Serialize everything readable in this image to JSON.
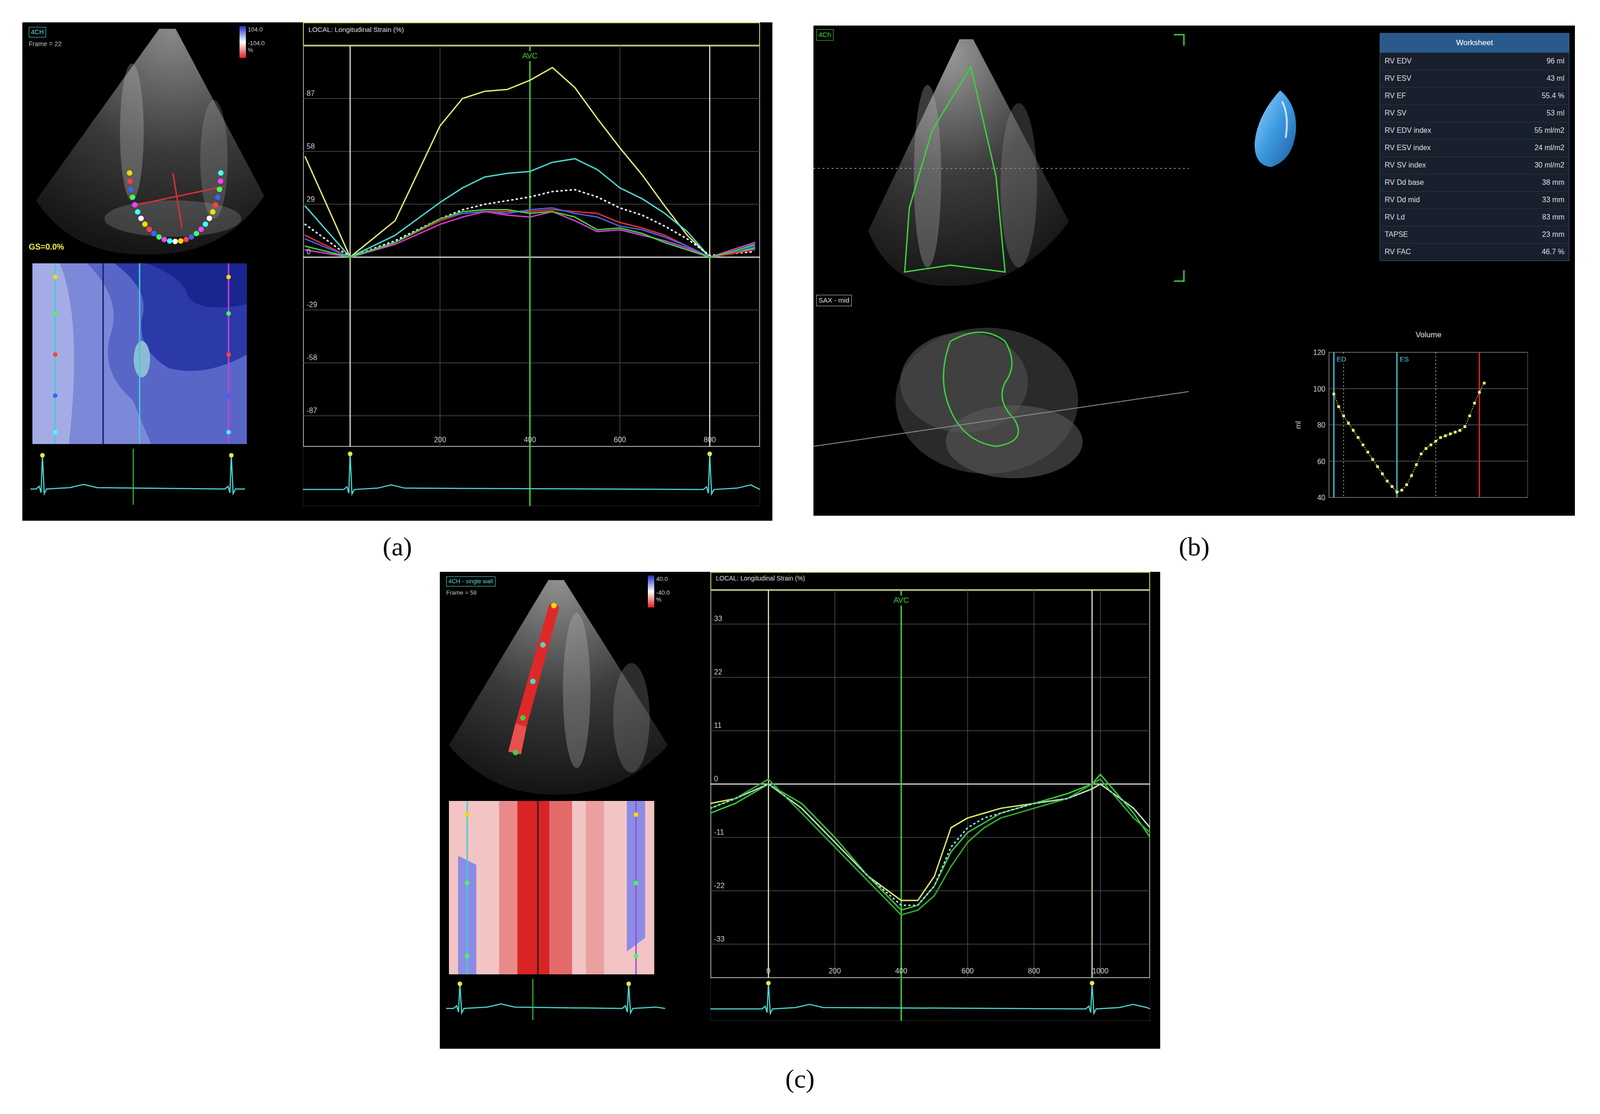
{
  "panel_a": {
    "caption": "(a)",
    "view_label": "4CH",
    "frame": "Frame = 22",
    "color_scale": {
      "max": "104.0",
      "unit": "%",
      "min": "-104.0"
    },
    "global_strain": "GS=0.0%",
    "chart": {
      "title": "LOCAL: Longitudinal Strain (%)",
      "marker": {
        "label": "AVC",
        "x": 400
      },
      "event_lines": [
        0,
        800
      ],
      "x_range": [
        -105,
        912
      ],
      "y_range": [
        -104,
        116
      ],
      "y_ticks": [
        "87",
        "58",
        "29",
        "0",
        "-29",
        "-58",
        "-87"
      ],
      "x_ticks": [
        "200",
        "400",
        "600",
        "800"
      ],
      "x": [
        -100,
        0,
        100,
        200,
        250,
        300,
        350,
        400,
        450,
        500,
        550,
        600,
        650,
        700,
        750,
        800,
        850,
        900
      ],
      "series": [
        {
          "color": "#e6e66a",
          "kind": "solid",
          "values": [
            55,
            0,
            20,
            72,
            87,
            91,
            92,
            97,
            104,
            93,
            76,
            60,
            45,
            28,
            12,
            0,
            3,
            6
          ]
        },
        {
          "color": "#4ad8d0",
          "kind": "solid",
          "values": [
            28,
            0,
            12,
            30,
            38,
            44,
            46,
            47,
            52,
            54,
            48,
            38,
            32,
            24,
            14,
            0,
            2,
            5
          ]
        },
        {
          "color": "#ffffff",
          "kind": "dotted",
          "values": [
            18,
            0,
            9,
            21,
            26,
            29,
            31,
            33,
            36,
            37,
            33,
            27,
            23,
            17,
            10,
            1,
            2,
            3
          ]
        },
        {
          "color": "#e03030",
          "kind": "solid",
          "values": [
            12,
            0,
            8,
            20,
            24,
            25,
            25,
            25,
            26,
            25,
            24,
            19,
            16,
            12,
            6,
            0,
            2,
            4
          ]
        },
        {
          "color": "#4a60e0",
          "kind": "solid",
          "values": [
            10,
            0,
            8,
            21,
            24,
            25,
            24,
            26,
            27,
            24,
            22,
            17,
            15,
            11,
            6,
            0,
            3,
            6
          ]
        },
        {
          "color": "#d040d0",
          "kind": "solid",
          "values": [
            4,
            0,
            7,
            18,
            22,
            25,
            23,
            22,
            25,
            20,
            14,
            15,
            12,
            9,
            5,
            0,
            4,
            8
          ]
        },
        {
          "color": "#40d040",
          "kind": "solid",
          "values": [
            6,
            0,
            8,
            21,
            25,
            26,
            26,
            24,
            25,
            22,
            15,
            16,
            13,
            8,
            4,
            0,
            3,
            7
          ]
        }
      ]
    }
  },
  "panel_b": {
    "caption": "(b)",
    "view_labels": [
      "4Ch",
      "SAX - mid"
    ],
    "worksheet": {
      "title": "Worksheet",
      "rows": [
        {
          "label": "RV EDV",
          "value": "96 ml"
        },
        {
          "label": "RV ESV",
          "value": "43 ml"
        },
        {
          "label": "RV EF",
          "value": "55.4 %"
        },
        {
          "label": "RV SV",
          "value": "53 ml"
        },
        {
          "label": "RV EDV index",
          "value": "55 ml/m2"
        },
        {
          "label": "RV ESV index",
          "value": "24 ml/m2"
        },
        {
          "label": "RV SV index",
          "value": "30 ml/m2"
        },
        {
          "label": "RV Dd base",
          "value": "38 mm"
        },
        {
          "label": "RV Dd mid",
          "value": "33 mm"
        },
        {
          "label": "RV Ld",
          "value": "83 mm"
        },
        {
          "label": "TAPSE",
          "value": "23 mm"
        },
        {
          "label": "RV FAC",
          "value": "46.7 %"
        }
      ]
    },
    "volume_chart": {
      "title": "Volume",
      "y_label": "ml",
      "y_ticks": [
        "120",
        "100",
        "80",
        "60",
        "40"
      ],
      "y_range": [
        40,
        120
      ],
      "x_range": [
        -1,
        40
      ],
      "markers": [
        {
          "label": "ED",
          "index": 0
        },
        {
          "label": "ES",
          "index": 13
        }
      ],
      "event_lines": [
        2,
        21
      ],
      "end_line": 30,
      "values": [
        97,
        90,
        85,
        81,
        77,
        73,
        69,
        65,
        61,
        57,
        53,
        49,
        46,
        43,
        44,
        47,
        52,
        58,
        64,
        67,
        69,
        71,
        73,
        74,
        75,
        76,
        77,
        79,
        85,
        92,
        98,
        103
      ]
    }
  },
  "panel_c": {
    "caption": "(c)",
    "view_label": "4CH - single wall",
    "frame": "Frame = 58",
    "color_scale": {
      "max": "40.0",
      "unit": "%",
      "min": "-40.0"
    },
    "chart": {
      "title": "LOCAL: Longitudinal Strain (%)",
      "marker": {
        "label": "AVC",
        "x": 400
      },
      "event_lines": [
        0,
        975
      ],
      "x_range": [
        -175,
        1150
      ],
      "y_range": [
        -40,
        40
      ],
      "y_ticks": [
        "33",
        "22",
        "11",
        "0",
        "-11",
        "-22",
        "-33"
      ],
      "x_ticks": [
        "0",
        "200",
        "400",
        "600",
        "800",
        "1000"
      ],
      "x": [
        -175,
        -100,
        0,
        100,
        200,
        300,
        400,
        450,
        500,
        550,
        600,
        650,
        700,
        800,
        900,
        975,
        1000,
        1100,
        1150
      ],
      "series": [
        {
          "color": "#e6e66a",
          "kind": "solid",
          "values": [
            -4,
            -3,
            0,
            -5,
            -12,
            -19,
            -24,
            -24,
            -19,
            -9,
            -7,
            -6,
            -5,
            -4,
            -3,
            -1,
            0,
            -5,
            -9
          ]
        },
        {
          "color": "#3cc83c",
          "kind": "solid",
          "values": [
            -6,
            -4,
            0,
            -4,
            -11,
            -19,
            -26,
            -25,
            -21,
            -14,
            -10,
            -8,
            -6,
            -4,
            -2,
            0,
            2,
            -6,
            -11
          ]
        },
        {
          "color": "#2fae2f",
          "kind": "solid",
          "values": [
            -5,
            -3,
            1,
            -6,
            -13,
            -20,
            -27,
            -26,
            -23,
            -17,
            -12,
            -9,
            -7,
            -5,
            -3,
            0,
            1,
            -7,
            -10
          ]
        },
        {
          "color": "#8fd8ff",
          "kind": "dotted",
          "values": [
            -5,
            -3,
            0,
            -5,
            -12,
            -19,
            -25,
            -25,
            -21,
            -13,
            -9,
            -7,
            -6,
            -4,
            -3,
            -1,
            0,
            -5,
            -9
          ]
        }
      ]
    }
  }
}
